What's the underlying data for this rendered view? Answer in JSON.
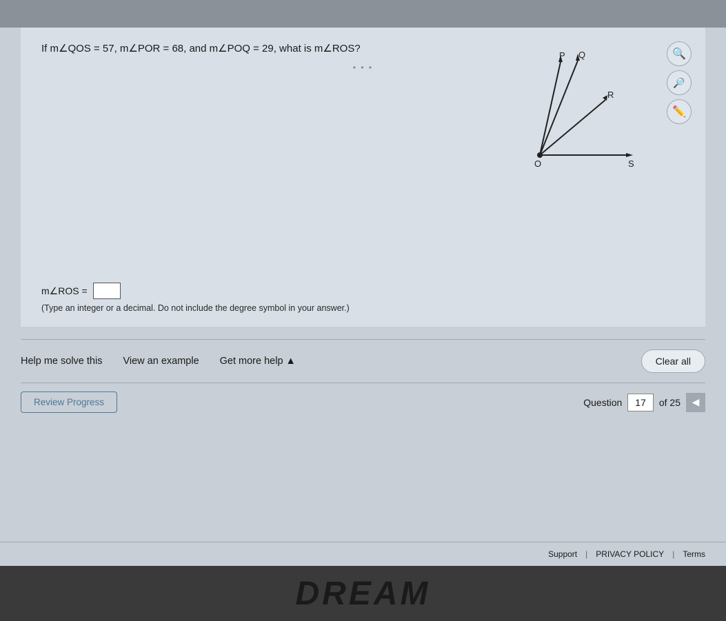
{
  "question": {
    "text": "If m∠QOS = 57, m∠POR = 68, and m∠POQ = 29, what is m∠ROS?",
    "answer_label": "m∠ROS =",
    "answer_hint": "(Type an integer or a decimal. Do not include the degree symbol in your answer.)",
    "answer_value": ""
  },
  "toolbar": {
    "zoom_in_icon": "🔍",
    "zoom_out_icon": "🔍",
    "edit_icon": "✏️"
  },
  "help": {
    "help_me_solve": "Help me solve this",
    "view_example": "View an example",
    "get_more_help": "Get more help ▲"
  },
  "clear_button": "Clear all",
  "review_progress_button": "Review Progress",
  "pagination": {
    "question_label": "Question",
    "current": "17",
    "of_label": "of 25"
  },
  "footer": {
    "support": "Support",
    "privacy_policy": "PRIVACY POLICY",
    "terms": "Terms"
  },
  "dots": "• • •",
  "bottom_text": "DREAM"
}
